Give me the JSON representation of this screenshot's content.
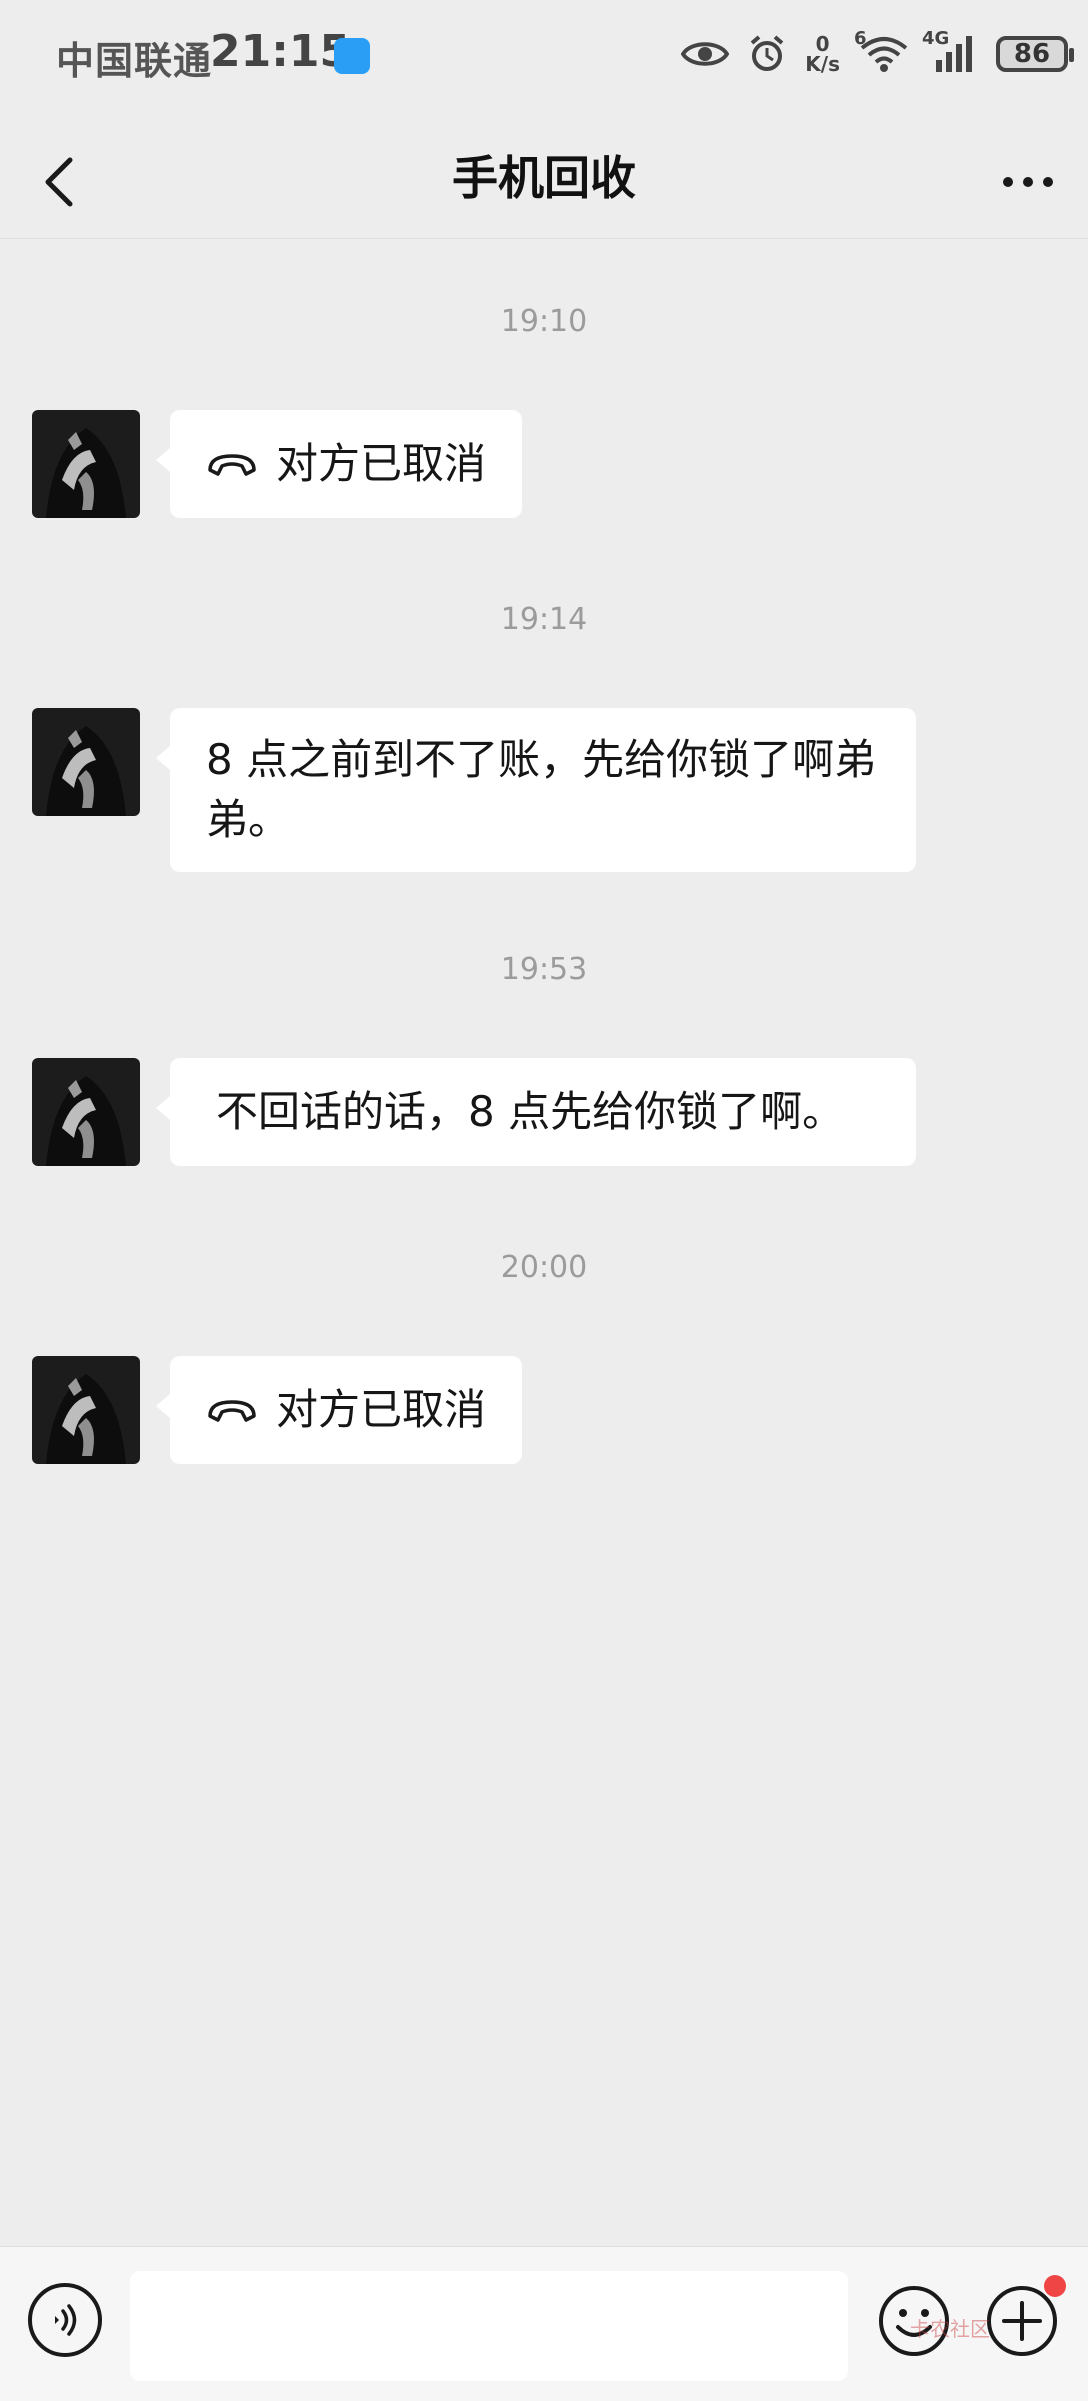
{
  "status_bar": {
    "carrier": "中国联通",
    "time": "21:15",
    "net_speed_value": "0",
    "net_speed_unit": "K/s",
    "wifi_badge": "6",
    "cell_badge": "4G",
    "battery_level": "86"
  },
  "header": {
    "title": "手机回收"
  },
  "messages": [
    {
      "timestamp": "19:10",
      "type": "call",
      "text": "对方已取消"
    },
    {
      "timestamp": "19:14",
      "type": "text",
      "text": "8 点之前到不了账，先给你锁了啊弟弟。"
    },
    {
      "timestamp": "19:53",
      "type": "text",
      "text": "不回话的话，8 点先给你锁了啊。"
    },
    {
      "timestamp": "20:00",
      "type": "call",
      "text": "对方已取消"
    }
  ],
  "composer": {
    "input_value": "",
    "watermark": "卡农社区"
  },
  "colors": {
    "background": "#ededed",
    "bubble": "#ffffff",
    "timestamp": "#9b9b9b",
    "notification_dot": "#f04545"
  },
  "icons": {
    "back": "chevron-left-icon",
    "more": "more-dots-icon",
    "call": "phone-hangup-icon",
    "voice": "voice-icon",
    "emoji": "emoji-icon",
    "plus": "plus-circle-icon"
  }
}
